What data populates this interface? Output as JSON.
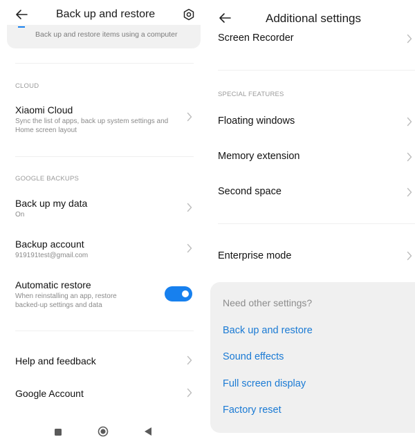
{
  "left": {
    "title": "Back up and restore",
    "card_text": "Back up and restore items using a computer",
    "cloud_section": "CLOUD",
    "xiaomi_cloud": {
      "title": "Xiaomi Cloud",
      "subtitle": "Sync the list of apps, back up system settings and Home screen layout"
    },
    "google_section": "GOOGLE BACKUPS",
    "backup_my_data": {
      "title": "Back up my data",
      "subtitle": "On"
    },
    "backup_account": {
      "title": "Backup account",
      "subtitle": "919191test@gmail.com"
    },
    "automatic_restore": {
      "title": "Automatic restore",
      "subtitle": "When reinstalling an app, restore backed-up settings and data",
      "enabled": true
    },
    "help_feedback": "Help and feedback",
    "google_account": "Google Account"
  },
  "right": {
    "title": "Additional settings",
    "screen_recorder": "Screen Recorder",
    "special_section": "SPECIAL FEATURES",
    "floating_windows": "Floating windows",
    "memory_extension": "Memory extension",
    "second_space": "Second space",
    "enterprise_mode": "Enterprise mode",
    "card": {
      "heading": "Need other settings?",
      "links": [
        "Back up and restore",
        "Sound effects",
        "Full screen display",
        "Factory reset"
      ]
    }
  },
  "icons": {
    "back": "arrow-left-icon",
    "settings": "gear-icon",
    "chevron": "chevron-right-icon",
    "nav_recents": "square-icon",
    "nav_home": "circle-icon",
    "nav_back": "triangle-icon"
  },
  "colors": {
    "accent": "#1780ee",
    "link": "#1a7ad4",
    "card_bg": "#f0f0f0"
  }
}
